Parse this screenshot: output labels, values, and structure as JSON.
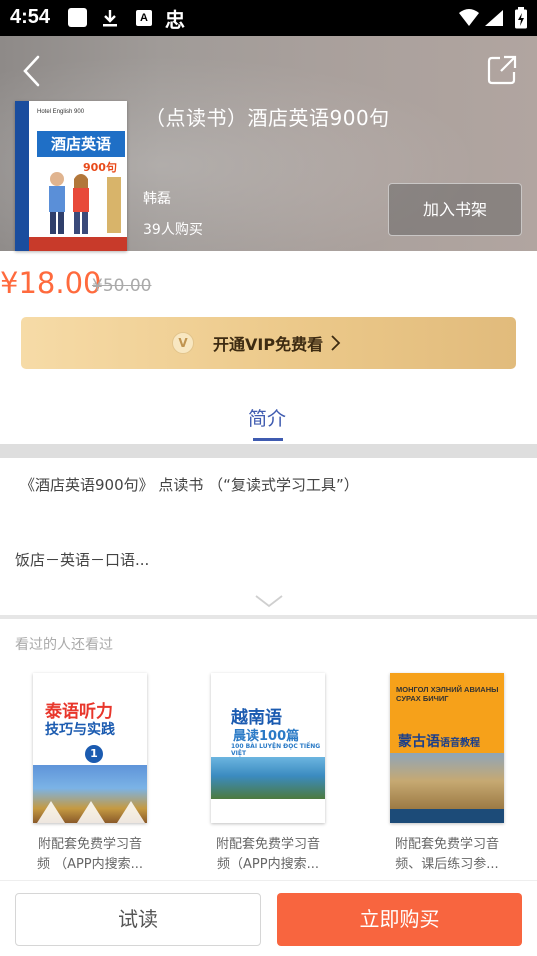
{
  "status_bar": {
    "time": "4:54",
    "a_glyph": "A",
    "chi_glyph": "忠",
    "icons": [
      "square-app-icon",
      "download-icon",
      "a-badge-icon",
      "chinese-app-icon",
      "wifi-icon",
      "signal-icon",
      "battery-icon"
    ]
  },
  "header": {
    "title": "（点读书）酒店英语900句",
    "author": "韩磊",
    "buyers": "39人购买",
    "shelf_button": "加入书架",
    "cover": {
      "english_text": "Hotel English 900",
      "title": "酒店英语",
      "subtitle": "900句"
    }
  },
  "price": {
    "current": "¥18.00",
    "original": "¥50.00"
  },
  "vip": {
    "badge": "V",
    "label": "开通VIP免费看"
  },
  "tabs": {
    "intro": "简介"
  },
  "description": {
    "line1": "《酒店英语900句》 点读书 （“复读式学习工具”）",
    "line2": "饭店－英语－口语..."
  },
  "recommendations": {
    "title": "看过的人还看过",
    "items": [
      {
        "cover_title": "泰语听力",
        "cover_subtitle": "技巧与实践",
        "cover_number": "1",
        "caption_line1": "附配套免费学习音",
        "caption_line2": "频 （APP内搜索..."
      },
      {
        "cover_title": "越南语",
        "cover_subtitle": "晨读100篇",
        "cover_foreign": "100 BÀI LUYỆN ĐỌC TIẾNG VIỆT",
        "caption_line1": "附配套免费学习音",
        "caption_line2": "频（APP内搜索..."
      },
      {
        "cover_foreign": "МОНГОЛ ХЭЛНИЙ АВИАНЫ СУРАХ БИЧИГ",
        "cover_title": "蒙古语",
        "cover_subtitle": "语音教程",
        "caption_line1": "附配套免费学习音",
        "caption_line2": "频、课后练习参..."
      }
    ]
  },
  "bottom_bar": {
    "trial": "试读",
    "buy": "立即购买"
  },
  "colors": {
    "accent_price": "#ff6a3d",
    "tab_active": "#3f5bb0",
    "buy_button": "#f8653f",
    "vip_gold": "#ecc98a"
  }
}
